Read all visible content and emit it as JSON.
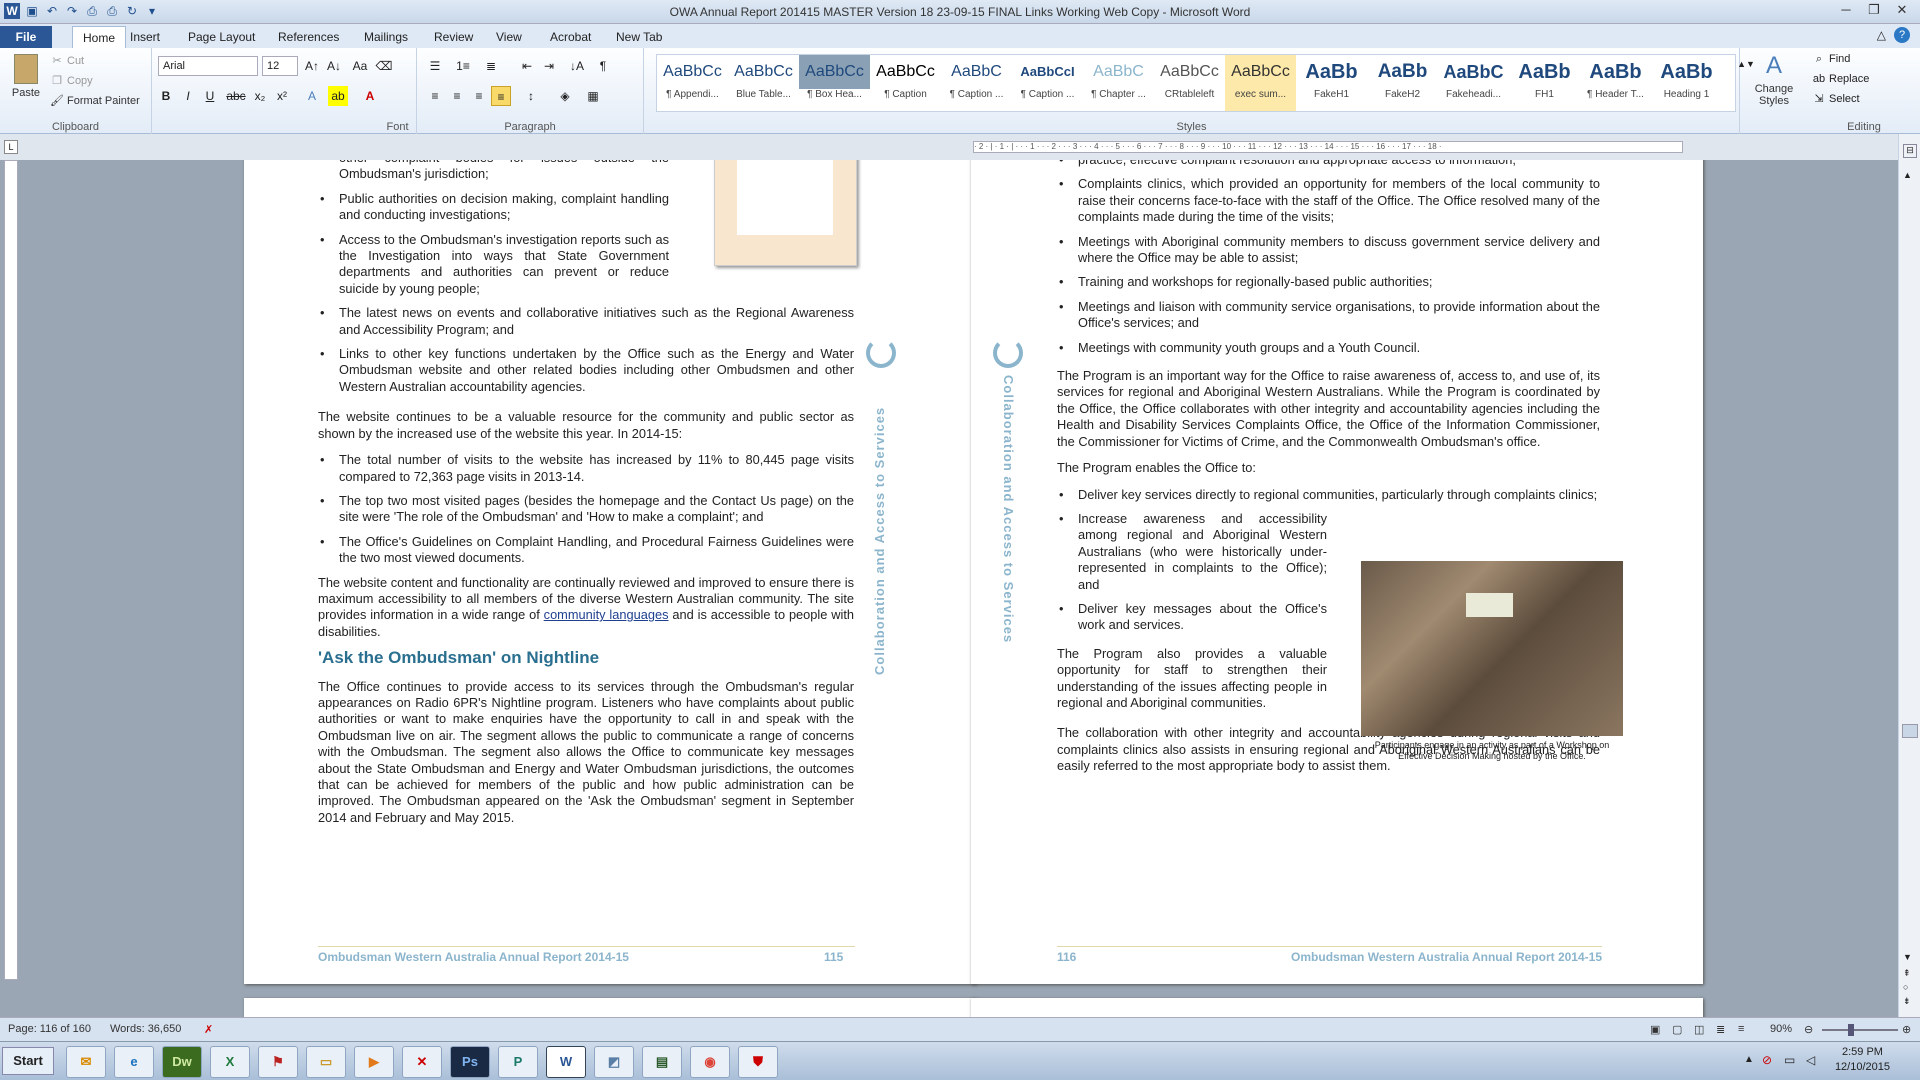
{
  "window": {
    "title": "OWA Annual Report 201415 MASTER Version 18 23-09-15 FINAL Links Working Web Copy - Microsoft Word"
  },
  "tabs": [
    "File",
    "Home",
    "Insert",
    "Page Layout",
    "References",
    "Mailings",
    "Review",
    "View",
    "Acrobat",
    "New Tab"
  ],
  "clipboard": {
    "paste": "Paste",
    "cut": "Cut",
    "copy": "Copy",
    "format_painter": "Format Painter",
    "label": "Clipboard"
  },
  "font": {
    "name": "Arial",
    "size": "12",
    "label": "Font"
  },
  "paragraph": {
    "label": "Paragraph"
  },
  "styles": {
    "label": "Styles",
    "items": [
      {
        "preview": "AaBbCc",
        "name": "¶ Appendi..."
      },
      {
        "preview": "AaBbCc",
        "name": "Blue Table..."
      },
      {
        "preview": "AaBbCc",
        "name": "¶ Box Hea..."
      },
      {
        "preview": "AaBbCc",
        "name": "¶ Caption"
      },
      {
        "preview": "AaBbC",
        "name": "¶ Caption ..."
      },
      {
        "preview": "AaBbCcI",
        "name": "¶ Caption ..."
      },
      {
        "preview": "AaBbC",
        "name": "¶ Chapter ..."
      },
      {
        "preview": "AaBbCc",
        "name": "CRtableleft"
      },
      {
        "preview": "AaBbCc",
        "name": "exec sum..."
      },
      {
        "preview": "AaBb",
        "name": "FakeH1"
      },
      {
        "preview": "AaBb",
        "name": "FakeH2"
      },
      {
        "preview": "AaBbC",
        "name": "Fakeheadi..."
      },
      {
        "preview": "AaBb",
        "name": "FH1"
      },
      {
        "preview": "AaBb",
        "name": "¶ Header T..."
      },
      {
        "preview": "AaBb",
        "name": "Heading 1"
      }
    ],
    "change": "Change Styles"
  },
  "editing": {
    "find": "Find",
    "replace": "Replace",
    "select": "Select",
    "label": "Editing"
  },
  "ruler": "· 2 · | · 1 · | · · · 1 · · · 2 · · · 3 · · · 4 · · · 5 · · · 6 · · · 7 · · · 8 · · · 9 · · · 10 · · · 11 · · · 12 · · · 13 · · · 14 · · · 15 · · · 16 · · · 17 · · · 18 ·",
  "page115": {
    "bullets_top": [
      "other complaint bodies for issues outside the Ombudsman's jurisdiction;",
      "Public authorities on decision making, complaint handling and conducting investigations;",
      "Access to the Ombudsman's investigation reports such as the Investigation into ways that State Government departments and authorities can prevent or reduce suicide by young people;",
      "The latest news on events and collaborative initiatives such as the Regional Awareness and Accessibility Program; and",
      "Links to other key functions undertaken by the Office such as the Energy and Water Ombudsman website and other related bodies including other Ombudsmen and other Western Australian accountability agencies."
    ],
    "para1": "The website continues to be a valuable resource for the community and public sector as shown by the increased use of the website this year. In 2014-15:",
    "bullets_mid": [
      "The total number of visits to the website has increased by 11% to 80,445 page visits compared to 72,363 page visits in 2013-14.",
      "The top two most visited pages (besides the homepage and the Contact Us page) on the site were 'The role of the Ombudsman' and 'How to make a complaint'; and",
      "The Office's Guidelines on Complaint Handling, and Procedural Fairness Guidelines were the two most viewed documents."
    ],
    "para2a": "The website content and functionality are continually reviewed and improved to ensure there is maximum accessibility to all members of the diverse Western Australian community. The site provides information in a wide range of ",
    "para2link": "community languages",
    "para2b": " and is accessible to people with disabilities.",
    "heading": "'Ask the Ombudsman' on Nightline",
    "para3": "The Office continues to provide access to its services through the Ombudsman's regular appearances on Radio 6PR's Nightline program. Listeners who have complaints about public authorities or want to make enquiries have the opportunity to call in and speak with the Ombudsman live on air. The segment allows the public to communicate a range of concerns with the Ombudsman. The segment also allows the Office to communicate key messages about the State Ombudsman and Energy and Water Ombudsman jurisdictions, the outcomes that can be achieved for members of the public and how public administration can be improved. The Ombudsman appeared on the 'Ask the Ombudsman' segment in September 2014 and February and May 2015.",
    "side": "Collaboration and Access to Services",
    "footer_left": "Ombudsman Western Australia Annual Report 2014-15",
    "footer_num": "115"
  },
  "page116": {
    "bullets_top": [
      "practice, effective complaint resolution and appropriate access to information;",
      "Complaints clinics, which provided an opportunity for members of the local community to raise their concerns face-to-face with the staff of the Office. The Office resolved many of the complaints made during the time of the visits;",
      "Meetings with Aboriginal community members to discuss government service delivery and where the Office may be able to assist;",
      "Training and workshops for regionally-based public authorities;",
      "Meetings and liaison with community service organisations, to provide information about the Office's services; and",
      "Meetings with community youth groups and a Youth Council."
    ],
    "para1": "The Program is an important way for the Office to raise awareness of, access to, and use of, its services for regional and Aboriginal Western Australians.  While the Program is coordinated by the Office, the Office collaborates with other integrity and accountability agencies including the Health and Disability Services Complaints Office, the Office of the Information Commissioner, the Commissioner for Victims of Crime, and the Commonwealth Ombudsman's office.",
    "para2": "The Program enables the Office to:",
    "bullets_mid": [
      "Deliver key services directly to regional communities, particularly through complaints clinics;",
      "Increase awareness and accessibility among regional and Aboriginal Western Australians (who were historically under-represented in complaints to the Office); and",
      "Deliver key messages about the Office's work and services."
    ],
    "para3": "The Program also provides a valuable opportunity for staff to strengthen their understanding of the issues affecting people in regional and Aboriginal communities.",
    "caption": "Participants engage in an activity as part of a Workshop on Effective Decision Making hosted by the Office.",
    "para4": "The collaboration with other integrity and accountability agencies during regional visits and complaints clinics also assists in ensuring regional and Aboriginal Western Australians can be easily referred to the most appropriate body to assist them.",
    "side": "Collaboration and Access to Services",
    "footer_num": "116",
    "footer_right": "Ombudsman Western Australia Annual Report 2014-15"
  },
  "status": {
    "page": "Page: 116 of 160",
    "words": "Words: 36,650",
    "zoom": "90%"
  },
  "taskbar": {
    "start": "Start",
    "time": "2:59 PM",
    "date": "12/10/2015"
  }
}
